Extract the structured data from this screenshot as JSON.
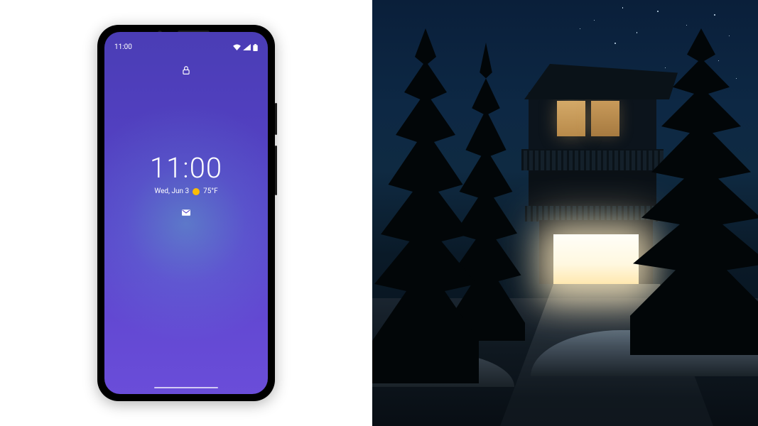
{
  "phone": {
    "status": {
      "time": "11:00"
    },
    "lock_screen": {
      "clock": "11:00",
      "date": "Wed, Jun 3",
      "temperature": "75°F"
    }
  }
}
